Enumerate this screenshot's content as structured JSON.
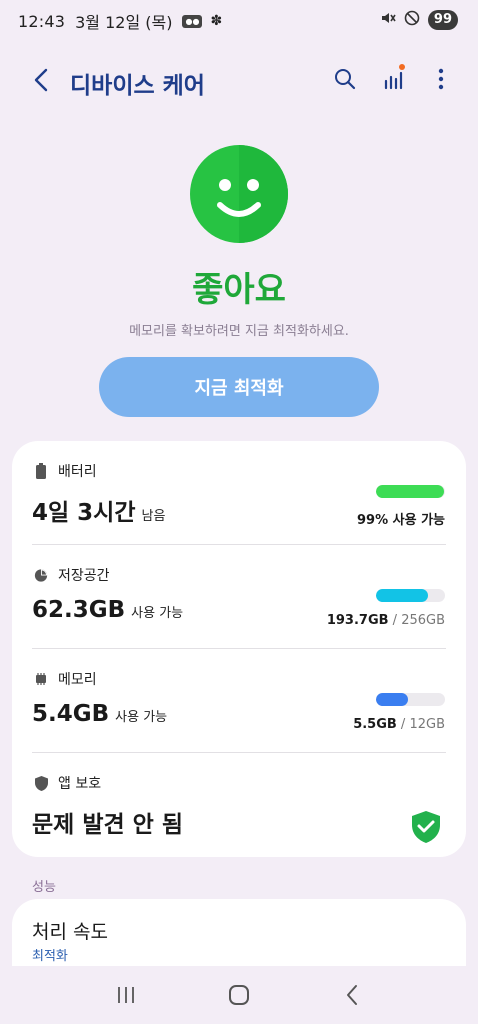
{
  "status_bar": {
    "time": "12:43",
    "date": "3월 12일 (목)",
    "battery": "99"
  },
  "app_bar": {
    "title": "디바이스 케어"
  },
  "hero": {
    "title": "좋아요",
    "subtitle": "메모리를 확보하려면 지금 최적화하세요.",
    "button_label": "지금 최적화"
  },
  "sections": {
    "battery": {
      "label": "배터리",
      "value": "4일 3시간",
      "unit": "남음",
      "right_text": "99% 사용 가능",
      "fill_percent": 99,
      "color": "#3ddc55"
    },
    "storage": {
      "label": "저장공간",
      "value": "62.3GB",
      "unit": "사용 가능",
      "used": "193.7GB",
      "sep": " / ",
      "total": "256GB",
      "fill_percent": 76,
      "color": "#12c3e6"
    },
    "memory": {
      "label": "메모리",
      "value": "5.4GB",
      "unit": "사용 가능",
      "used": "5.5GB",
      "sep": " / ",
      "total": "12GB",
      "fill_percent": 46,
      "color": "#3a7ef0"
    },
    "app_protection": {
      "label": "앱 보호",
      "value": "문제 발견 안 됨",
      "color": "#22b14c"
    }
  },
  "performance": {
    "section_label": "성능",
    "title": "처리 속도",
    "subtitle": "최적화"
  }
}
